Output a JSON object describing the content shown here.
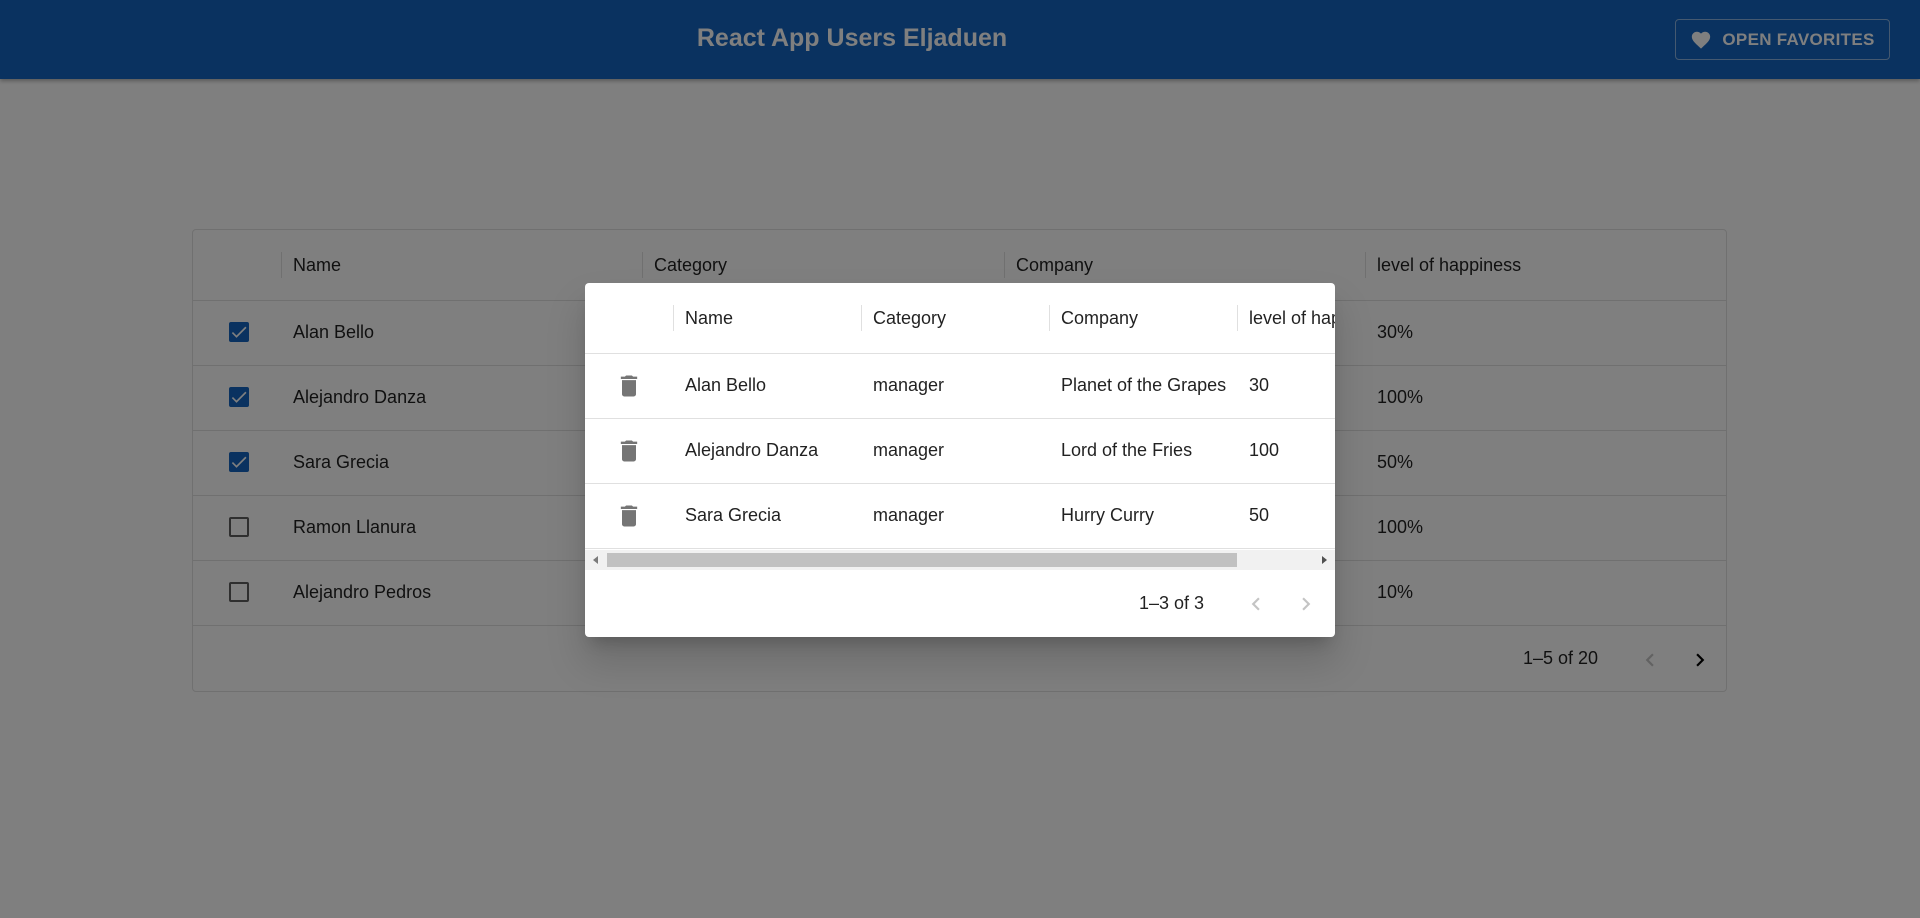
{
  "app": {
    "title": "React App Users Eljaduen",
    "favorites_button": "OPEN FAVORITES"
  },
  "main_grid": {
    "columns": [
      "Name",
      "Category",
      "Company",
      "level of happiness"
    ],
    "rows": [
      {
        "name": "Alan Bello",
        "happiness": "30%",
        "checked": true
      },
      {
        "name": "Alejandro Danza",
        "happiness": "100%",
        "checked": true
      },
      {
        "name": "Sara Grecia",
        "happiness": "50%",
        "checked": true
      },
      {
        "name": "Ramon Llanura",
        "happiness": "100%",
        "checked": false
      },
      {
        "name": "Alejandro Pedros",
        "happiness": "10%",
        "checked": false
      }
    ],
    "pagination": "1–5 of 20"
  },
  "modal": {
    "columns": [
      "Name",
      "Category",
      "Company",
      "level of happiness"
    ],
    "rows": [
      {
        "name": "Alan Bello",
        "category": "manager",
        "company": "Planet of the Grapes",
        "level": "30"
      },
      {
        "name": "Alejandro Danza",
        "category": "manager",
        "company": "Lord of the Fries",
        "level": "100"
      },
      {
        "name": "Sara Grecia",
        "category": "manager",
        "company": "Hurry Curry",
        "level": "50"
      }
    ],
    "pagination": "1–3 of 3"
  },
  "colors": {
    "primary": "#1565c0",
    "icon": "#757575"
  },
  "icons": {
    "favorites": "heart-icon",
    "delete": "trash-icon",
    "checkbox": "checkbox-icon",
    "prev": "chevron-left-icon",
    "next": "chevron-right-icon"
  }
}
